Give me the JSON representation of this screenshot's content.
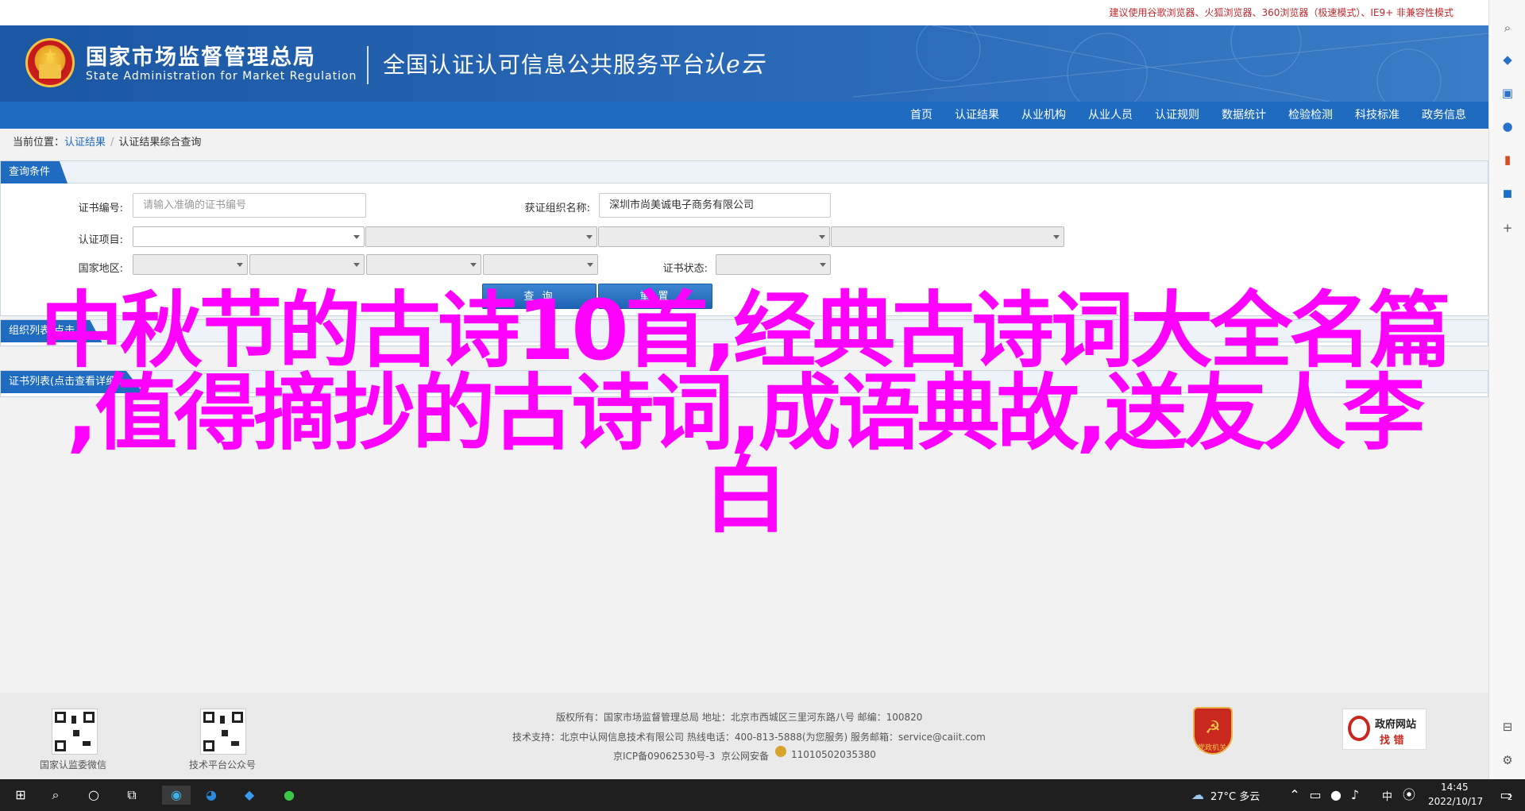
{
  "tip_bar": {
    "text": "建议使用谷歌浏览器、火狐浏览器、360浏览器（极速模式）、IE9+ 非兼容性模式"
  },
  "header": {
    "title_cn": "国家市场监督管理总局",
    "title_en": "State Administration  for  Market Regulation",
    "platform": "全国认证认可信息公共服务平台",
    "logo_text": "认e云"
  },
  "nav": {
    "items": [
      "首页",
      "认证结果",
      "从业机构",
      "从业人员",
      "认证规则",
      "数据统计",
      "检验检测",
      "科技标准",
      "政务信息"
    ]
  },
  "breadcrumb": {
    "prefix": "当前位置：",
    "link": "认证结果",
    "sep": "/",
    "current": "认证结果综合查询"
  },
  "query_panel": {
    "tab": "查询条件",
    "cert_no_label": "证书编号:",
    "cert_no_placeholder": "请输入准确的证书编号",
    "org_label": "获证组织名称:",
    "org_value": "深圳市尚美诚电子商务有限公司",
    "cert_item_label": "认证项目:",
    "region_label": "国家地区:",
    "status_label": "证书状态:",
    "search_button": "查 询",
    "reset_button": "重 置"
  },
  "list_panel": {
    "tab": "组织列表(点击..."
  },
  "detail_panel": {
    "tab": "证书列表(点击查看详细..."
  },
  "overlay": {
    "line1": "中秋节的古诗10首,经典古诗词大全名篇",
    "line2": ",值得摘抄的古诗词,成语典故,送友人李",
    "line3": "白"
  },
  "footer": {
    "qr1_label": "国家认监委微信",
    "qr2_label": "技术平台公众号",
    "line1": "版权所有：国家市场监督管理总局    地址：北京市西城区三里河东路八号    邮编：100820",
    "line2": "技术支持：北京中认网信息技术有限公司    热线电话：400-813-5888(为您服务)    服务邮箱：service@caiit.com",
    "icp": "京ICP备09062530号-3",
    "police": "京公网安备",
    "police_no": "11010502035380",
    "party_badge": "党政机关",
    "gov_find_title": "政府网站",
    "gov_find_sub": "找 错"
  },
  "taskbar": {
    "weather": "27°C  多云",
    "ime": "中",
    "time": "14:45",
    "date": "2022/10/17",
    "notify_count": "2"
  },
  "colors": {
    "brand_blue": "#1e6bbf",
    "overlay_magenta": "#ff00ff",
    "tip_red": "#c0282d"
  }
}
